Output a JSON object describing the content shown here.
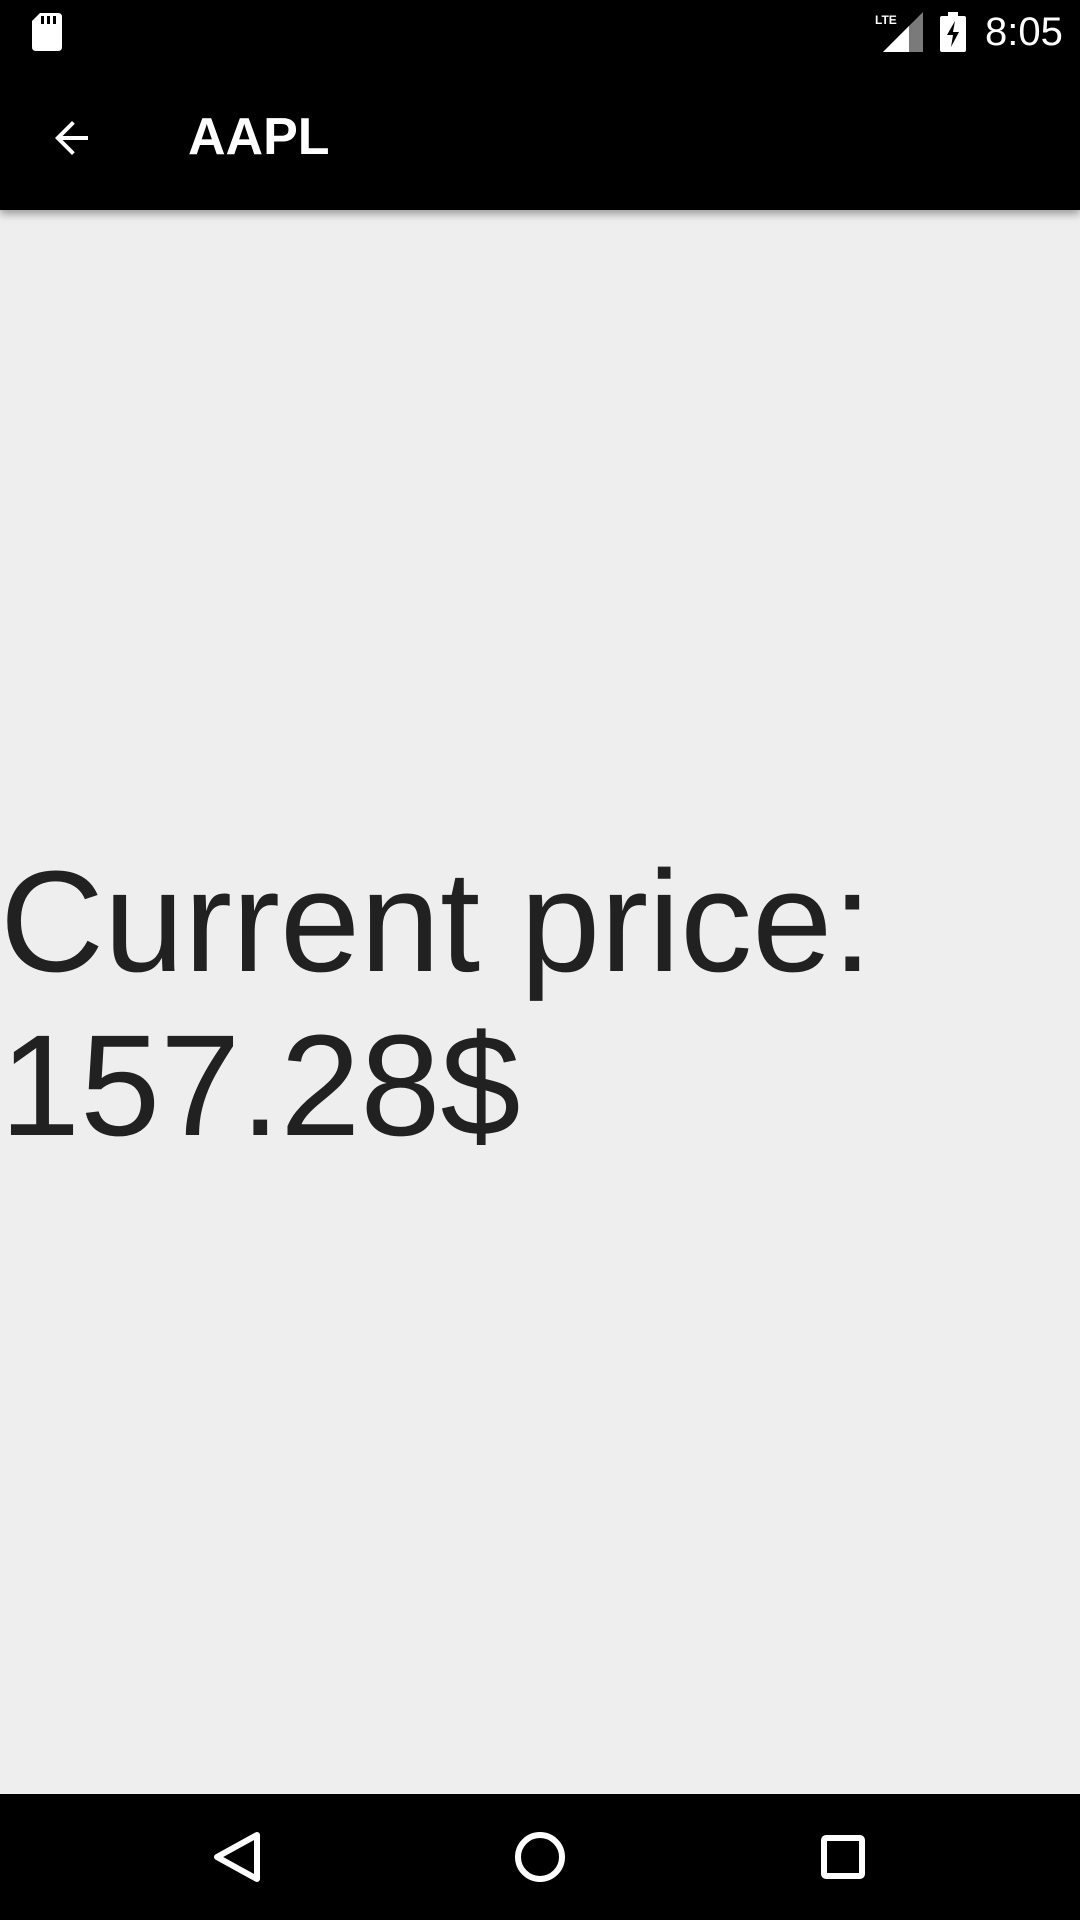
{
  "status_bar": {
    "time": "8:05",
    "network_label": "LTE",
    "icons": [
      "sd-card-icon",
      "signal-lte-icon",
      "battery-charging-icon"
    ]
  },
  "app_bar": {
    "title": "AAPL",
    "back_icon": "arrow-back-icon"
  },
  "main": {
    "price_label": "Current price:",
    "price_value": "157.28$"
  },
  "nav_bar": {
    "icons": [
      "nav-back-icon",
      "nav-home-icon",
      "nav-recents-icon"
    ]
  },
  "colors": {
    "bars": "#000000",
    "background": "#eeeeee",
    "text": "#212121"
  }
}
